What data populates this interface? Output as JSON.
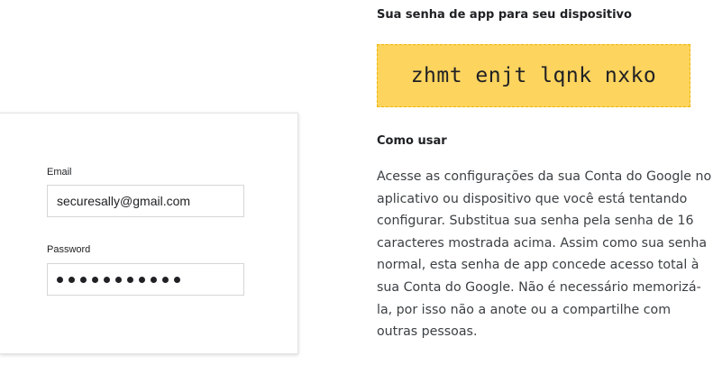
{
  "login": {
    "email_label": "Email",
    "email_value": "securesally@gmail.com",
    "password_label": "Password",
    "password_mask": "•••••••••••"
  },
  "app_password": {
    "heading": "Sua senha de app para seu dispositivo",
    "code": "zhmt enjt lqnk nxko",
    "code_background_color": "#fcd45e",
    "how_to_heading": "Como usar",
    "how_to_body": "Acesse as configurações da sua Conta do Google no aplicativo ou dispositivo que você está tentando configurar. Substitua sua senha pela senha de 16 caracteres mostrada acima. Assim como sua senha normal, esta senha de app concede acesso total à sua Conta do Google. Não é necessário memorizá-la, por isso não a anote ou a compartilhe com outras pessoas."
  }
}
